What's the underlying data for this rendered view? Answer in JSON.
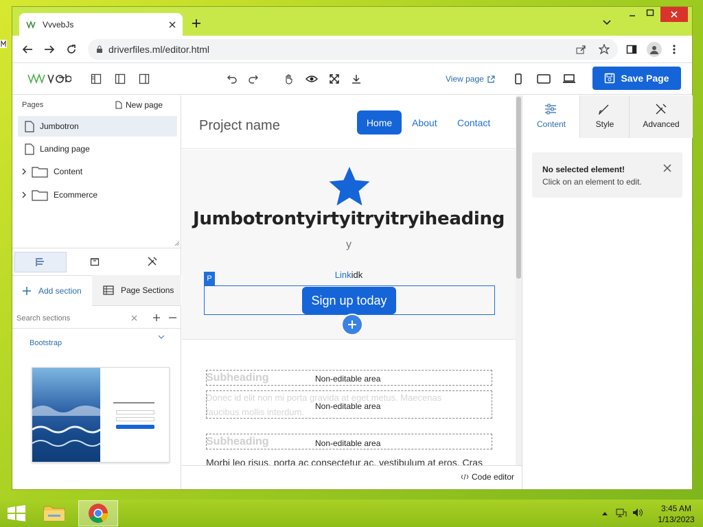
{
  "browser": {
    "tab_title": "VvvebJs",
    "url": "driverfiles.ml/editor.html"
  },
  "editor": {
    "view_page": "View page",
    "save_page": "Save Page"
  },
  "pages_panel": {
    "label": "Pages",
    "new_page": "New page",
    "items": [
      {
        "label": "Jumbotron"
      },
      {
        "label": "Landing page"
      },
      {
        "label": "Content"
      },
      {
        "label": "Ecommerce"
      }
    ]
  },
  "sections_panel": {
    "add_section": "Add section",
    "page_sections": "Page Sections",
    "search_placeholder": "Search sections",
    "group": "Bootstrap"
  },
  "canvas": {
    "project_name": "Project name",
    "nav": [
      "Home",
      "About",
      "Contact"
    ],
    "heading": "Jumbotrontyirtyitryitryiheading",
    "sub": "y",
    "link": "Link",
    "link_tail": "idk",
    "badge": "P",
    "cta": "Sign up today",
    "ghost1": "Subheading",
    "ghost2": "Donec id elit non mi porta gravida at eget metus. Maecenas",
    "ghost3": "faucibus mollis interdum.",
    "ghost4": "Subheading",
    "non_editable": "Non-editable area",
    "body_text": "Morbi leo risus, porta ac consectetur ac, vestibulum at eros. Cras",
    "code_editor": "Code editor"
  },
  "right_panel": {
    "tabs": [
      "Content",
      "Style",
      "Advanced"
    ],
    "notice_title": "No selected element!",
    "notice_text": "Click on an element to edit."
  },
  "taskbar": {
    "time": "3:45 AM",
    "date": "1/13/2023"
  },
  "colors": {
    "accent": "#1565d8",
    "browser_chrome": "#c8e84a"
  }
}
